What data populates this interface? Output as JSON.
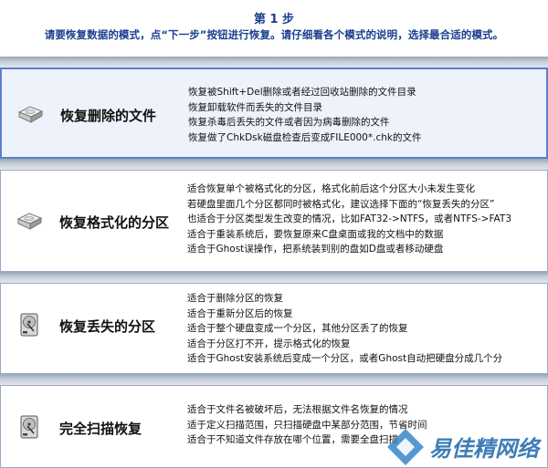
{
  "header": {
    "step_title": "第 1 步",
    "step_desc": "请要恢复数据的模式，点“下一步”按钮进行恢复。请仔细看各个模式的说明，选择最合适的模式。"
  },
  "modes": [
    {
      "title": "恢复删除的文件",
      "icon": "hard-disk-icon",
      "selected": true,
      "lines": [
        "恢复被Shift+Del删除或者经过回收站删除的文件目录",
        "恢复卸载软件而丢失的文件目录",
        "恢复杀毒后丢失的文件或者因为病毒删除的文件",
        "恢复做了ChkDsk磁盘检查后变成FILE000*.chk的文件"
      ]
    },
    {
      "title": "恢复格式化的分区",
      "icon": "hard-disk-icon",
      "selected": false,
      "lines": [
        "适合恢复单个被格式化的分区，格式化前后这个分区大小未发生变化",
        "若硬盘里面几个分区都同时被格式化，建议选择下面的“恢复丢失的分区”",
        "也适合于分区类型发生改变的情况，比如FAT32->NTFS，或者NTFS->FAT3",
        "适合于重装系统后，要恢复原来C盘桌面或我的文档中的数据",
        "适合于Ghost误操作，把系统装到别的盘如D盘或者移动硬盘"
      ]
    },
    {
      "title": "恢复丢失的分区",
      "icon": "hard-disk-open-icon",
      "selected": false,
      "lines": [
        "适合于删除分区的恢复",
        "适合于重新分区后的恢复",
        "适合于整个硬盘变成一个分区，其他分区丢了的恢复",
        "适合于分区打不开，提示格式化的恢复",
        "适合于Ghost安装系统后变成一个分区，或者Ghost自动把硬盘分成几个分"
      ]
    },
    {
      "title": "完全扫描恢复",
      "icon": "hard-disk-open-icon",
      "selected": false,
      "lines": [
        "适合于文件名被破坏后，无法根据文件名恢复的情况",
        "适于定义扫描范围，只扫描硬盘中某部分范围，节省时间",
        "适合于不知道文件存放在哪个位置，需要全盘扫描"
      ]
    }
  ],
  "watermark": "易佳精网络"
}
